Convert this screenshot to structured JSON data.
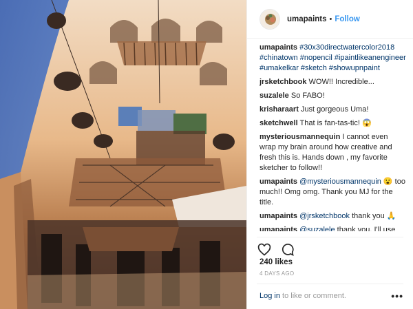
{
  "post": {
    "username": "umapaints",
    "separator": "•",
    "follow_label": "Follow",
    "caption": {
      "user": "umapaints",
      "hashtags": "#30x30directwatercolor2018 #chinatown #nopencil #ipaintlikeanengineer #umakelkar #sketch #showupnpaint"
    },
    "comments": [
      {
        "user": "jrsketchbook",
        "text": "WOW!! Incredible..."
      },
      {
        "user": "suzalele",
        "text": "So FABO!"
      },
      {
        "user": "krisharaart",
        "text": "Just gorgeous Uma!"
      },
      {
        "user": "sketchwell",
        "text": "That is fan-tas-tic! 😱"
      },
      {
        "user": "mysteriousmannequin",
        "text": "I cannot even wrap my brain around how creative and fresh this is. Hands down , my favorite sketcher to follow!!"
      },
      {
        "user": "umapaints",
        "mention": "@mysteriousmannequin",
        "text": "😮 too much!! Omg omg. Thank you MJ for the title."
      },
      {
        "user": "umapaints",
        "mention": "@jrsketchbook",
        "text": "thank you 🙏"
      },
      {
        "user": "umapaints",
        "mention": "@suzalele",
        "text": "thank you. I'll use 'Fabo' going forward."
      }
    ],
    "likes": "240 likes",
    "timestamp": "4 DAYS AGO",
    "footer": {
      "login_link": "Log in",
      "login_rest": "to like or comment.",
      "more": "•••"
    }
  },
  "icons": {
    "like": "heart-icon",
    "comment": "comment-bubble-icon",
    "more": "more-options-icon"
  },
  "colors": {
    "link_blue": "#3897f0",
    "mention_blue": "#003569",
    "muted": "#999999",
    "text": "#262626"
  }
}
